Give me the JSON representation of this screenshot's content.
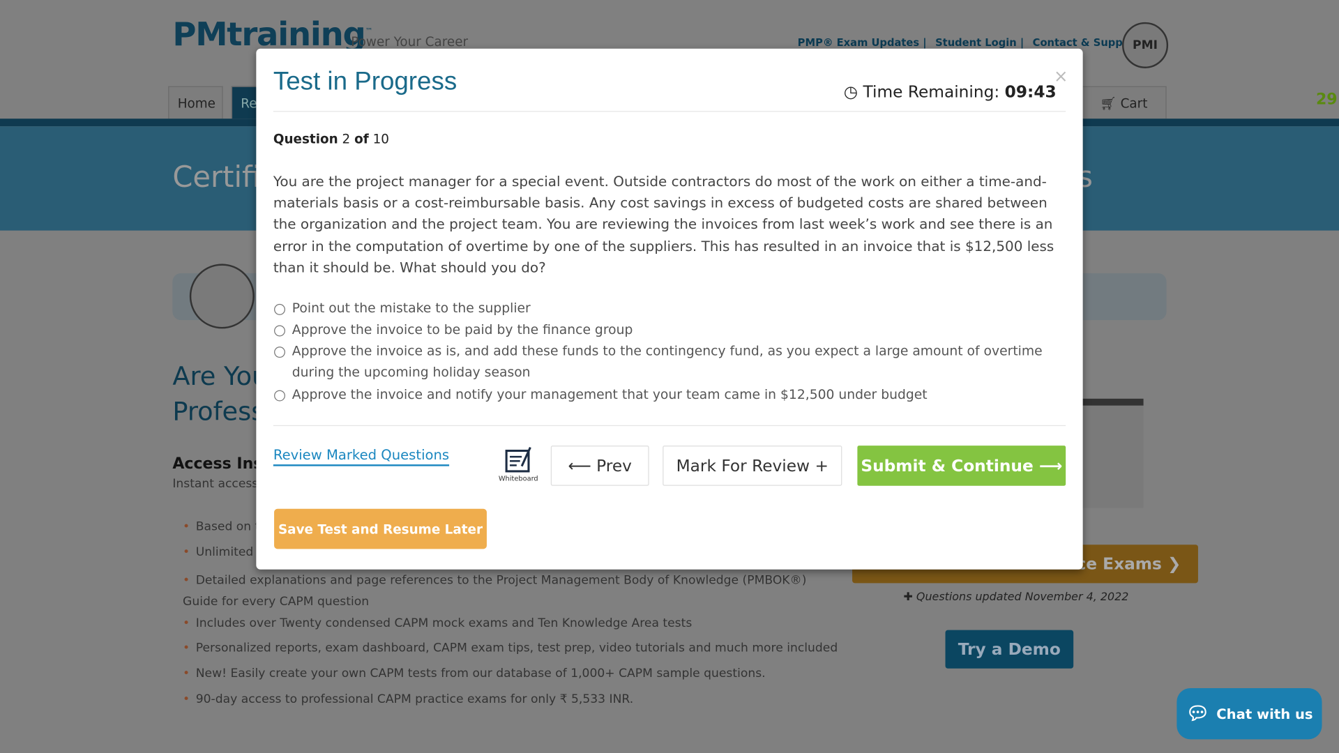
{
  "site": {
    "logo": "PMtraining",
    "logo_tm": "™",
    "tagline": "Power Your Career",
    "top_links": [
      "PMP® Exam Updates |",
      "Student Login |",
      "Contact & Support"
    ],
    "seal_text": "PMI",
    "nav": {
      "home": "Home",
      "resources": "Re",
      "cart": "Cart"
    },
    "counter": "29",
    "hero_title": "Certifi",
    "hero_title_tail": "s",
    "heading_line1": "Are You",
    "heading_line2": "Profess",
    "access_title": "Access Inst",
    "access_sub": "Instant access",
    "bullets": [
      "Based on th",
      "Unlimited a",
      "Detailed explanations and page references to the Project Management Body of Knowledge (PMBOK®) Guide for every CAPM question",
      "Includes over Twenty condensed CAPM mock exams and Ten Knowledge Area tests",
      "Personalized reports, exam dashboard, CAPM exam tips, test prep, video tutorials and much more included",
      "New! Easily create your own CAPM tests from our database of 1,000+ CAPM sample questions.",
      "90-day access to professional CAPM practice exams for only ₹ 5,533 INR."
    ],
    "practice_button": "tice Exams ❯",
    "updated_note": "✚ Questions updated November 4, 2022",
    "demo_button": "Try a Demo",
    "chat_button": "Chat with us"
  },
  "modal": {
    "title": "Test in Progress",
    "close": "×",
    "timer_label": "Time Remaining:",
    "timer_value": "09:43",
    "question_label": "Question",
    "question_num": "2",
    "question_of": "of",
    "question_total": "10",
    "question_text": "You are the project manager for a special event. Outside contractors do most of the work on either a time-and-materials basis or a cost-reimbursable basis. Any cost savings in excess of budgeted costs are shared between the organization and the project team. You are reviewing the invoices from last week’s work and see there is an error in the computation of overtime by one of the suppliers. This has resulted in an invoice that is $12,500 less than it should be. What should you do?",
    "options": [
      "Point out the mistake to the supplier",
      "Approve the invoice to be paid by the finance group",
      "Approve the invoice as is, and add these funds to the contingency fund, as you expect a large amount of overtime during the upcoming holiday season",
      "Approve the invoice and notify your management that your team came in $12,500 under budget"
    ],
    "review_marked": "Review Marked Questions",
    "whiteboard": "Whiteboard",
    "prev": "⟵ Prev",
    "mark_review": "Mark For Review +",
    "submit": "Submit & Continue ⟶",
    "save": "Save Test and Resume Later"
  },
  "colors": {
    "accent": "#1a6a8a",
    "submit": "#84c441",
    "save": "#efad4d",
    "link": "#1b87c0"
  }
}
